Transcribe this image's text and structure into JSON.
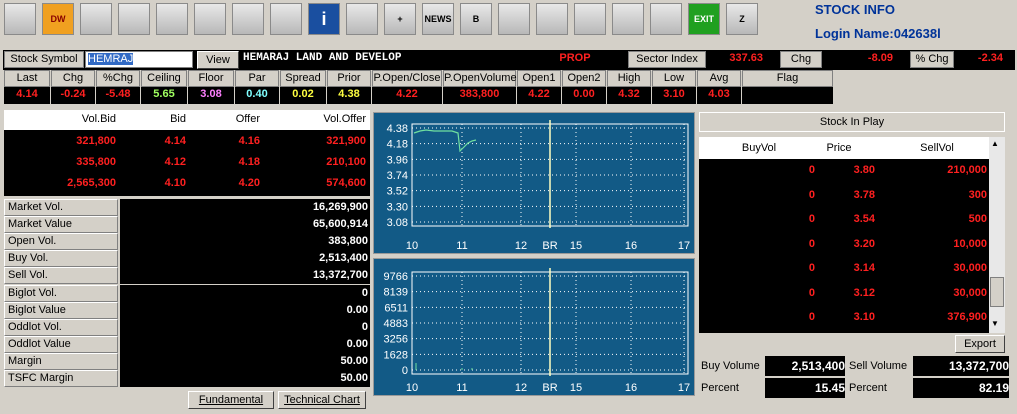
{
  "app": {
    "title": "STOCK INFO",
    "login": "Login Name:042638l"
  },
  "toolbar": [
    {
      "icon": "home-icon",
      "text": ""
    },
    {
      "icon": "dw-icon",
      "text": "DW"
    },
    {
      "icon": "clock-icon",
      "text": ""
    },
    {
      "icon": "arrows-icon",
      "text": ""
    },
    {
      "icon": "ticker-icon",
      "text": ""
    },
    {
      "icon": "chart-icon",
      "text": ""
    },
    {
      "icon": "line-chart-icon",
      "text": ""
    },
    {
      "icon": "bar-chart-icon",
      "text": ""
    },
    {
      "icon": "info-icon",
      "text": "i"
    },
    {
      "icon": "download-icon",
      "text": ""
    },
    {
      "icon": "add-icon",
      "text": "+"
    },
    {
      "icon": "news-icon",
      "text": "NEWS"
    },
    {
      "icon": "book-icon",
      "text": "B"
    },
    {
      "icon": "search-icon",
      "text": ""
    },
    {
      "icon": "notes-icon",
      "text": ""
    },
    {
      "icon": "edit-icon",
      "text": ""
    },
    {
      "icon": "alarm-icon",
      "text": ""
    },
    {
      "icon": "tools-icon",
      "text": ""
    },
    {
      "icon": "exit-icon",
      "text": "EXIT"
    },
    {
      "icon": "z-icon",
      "text": "Z"
    }
  ],
  "symbol": {
    "label": "Stock Symbol",
    "value": "HEMRAJ",
    "view": "View",
    "name": "HEMARAJ LAND AND DEVELOP",
    "type": "PROP",
    "sector_label": "Sector Index",
    "sector_value": "337.63",
    "chg_label": "Chg",
    "chg_value": "-8.09",
    "pchg_label": "% Chg",
    "pchg_value": "-2.34"
  },
  "quote": {
    "headers": [
      "Last",
      "Chg",
      "%Chg",
      "Ceiling",
      "Floor",
      "Par",
      "Spread",
      "Prior",
      "P.Open/Close",
      "P.OpenVolume",
      "Open1",
      "Open2",
      "High",
      "Low",
      "Avg",
      "Flag"
    ],
    "values": [
      "4.14",
      "-0.24",
      "-5.48",
      "5.65",
      "3.08",
      "0.40",
      "0.02",
      "4.38",
      "4.22",
      "383,800",
      "4.22",
      "0.00",
      "4.32",
      "3.10",
      "4.03",
      ""
    ]
  },
  "bidoffer": {
    "headers": [
      "Vol.Bid",
      "Bid",
      "Offer",
      "Vol.Offer"
    ],
    "rows": [
      [
        "321,800",
        "4.14",
        "4.16",
        "321,900"
      ],
      [
        "335,800",
        "4.12",
        "4.18",
        "210,100"
      ],
      [
        "2,565,300",
        "4.10",
        "4.20",
        "574,600"
      ]
    ]
  },
  "stats": [
    [
      "Market Vol.",
      "16,269,900"
    ],
    [
      "Market Value",
      "65,600,914"
    ],
    [
      "Open Vol.",
      "383,800"
    ],
    [
      "Buy Vol.",
      "2,513,400"
    ],
    [
      "Sell Vol.",
      "13,372,700"
    ],
    [
      "Biglot Vol.",
      "0"
    ],
    [
      "Biglot Value",
      "0.00"
    ],
    [
      "Oddlot Vol.",
      "0"
    ],
    [
      "Oddlot Value",
      "0.00"
    ],
    [
      "Margin",
      "50.00"
    ],
    [
      "TSFC Margin",
      "50.00"
    ]
  ],
  "buttons": {
    "fundamental": "Fundamental",
    "technical": "Technical Chart",
    "export": "Export"
  },
  "price_chart": {
    "yticks": [
      "4.38",
      "4.18",
      "3.96",
      "3.74",
      "3.52",
      "3.30",
      "3.08"
    ],
    "xticks": [
      "10",
      "11",
      "12",
      "BR",
      "15",
      "16",
      "17"
    ]
  },
  "volume_chart": {
    "yticks": [
      "9766",
      "8139",
      "6511",
      "4883",
      "3256",
      "1628",
      "0"
    ],
    "xticks": [
      "10",
      "11",
      "12",
      "BR",
      "15",
      "16",
      "17"
    ]
  },
  "inplay": {
    "title": "Stock In Play",
    "headers": [
      "BuyVol",
      "Price",
      "SellVol"
    ],
    "rows": [
      [
        "0",
        "3.80",
        "210,000"
      ],
      [
        "0",
        "3.78",
        "300"
      ],
      [
        "0",
        "3.54",
        "500"
      ],
      [
        "0",
        "3.20",
        "10,000"
      ],
      [
        "0",
        "3.14",
        "30,000"
      ],
      [
        "0",
        "3.12",
        "30,000"
      ],
      [
        "0",
        "3.10",
        "376,900"
      ]
    ]
  },
  "summary": {
    "buy_label": "Buy Volume",
    "buy_value": "2,513,400",
    "sell_label": "Sell Volume",
    "sell_value": "13,372,700",
    "pct_label": "Percent",
    "buy_pct": "15.45",
    "sell_pct": "82.19"
  }
}
